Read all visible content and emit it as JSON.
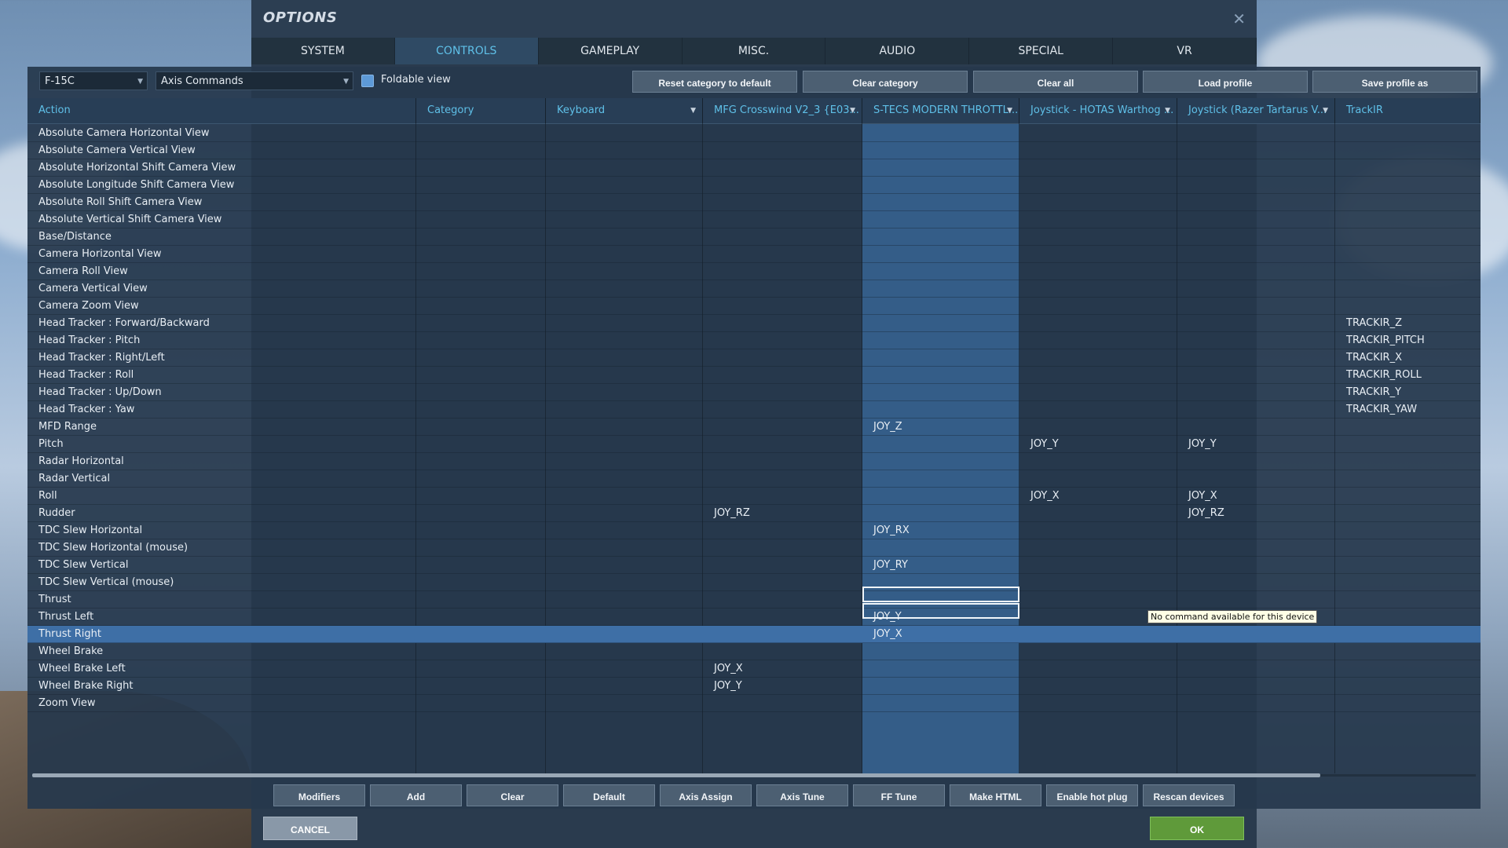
{
  "window": {
    "title": "OPTIONS"
  },
  "tabs": [
    {
      "label": "SYSTEM",
      "active": false
    },
    {
      "label": "CONTROLS",
      "active": true
    },
    {
      "label": "GAMEPLAY",
      "active": false
    },
    {
      "label": "MISC.",
      "active": false
    },
    {
      "label": "AUDIO",
      "active": false
    },
    {
      "label": "SPECIAL",
      "active": false
    },
    {
      "label": "VR",
      "active": false
    }
  ],
  "toolbar": {
    "aircraft": "F-15C",
    "category_filter": "Axis Commands",
    "foldable_label": "Foldable view",
    "reset_category": "Reset category to default",
    "clear_category": "Clear category",
    "clear_all": "Clear all",
    "load_profile": "Load profile",
    "save_profile_as": "Save profile as"
  },
  "columns": [
    {
      "label": "Action",
      "dropdown": false
    },
    {
      "label": "Category",
      "dropdown": false
    },
    {
      "label": "Keyboard",
      "dropdown": true
    },
    {
      "label": "MFG Crosswind V2_3 {E03...",
      "dropdown": true
    },
    {
      "label": "S-TECS MODERN THROTTL...",
      "dropdown": true
    },
    {
      "label": "Joystick - HOTAS Warthog ...",
      "dropdown": true
    },
    {
      "label": "Joystick (Razer Tartarus V...",
      "dropdown": true
    },
    {
      "label": "TrackIR",
      "dropdown": false
    }
  ],
  "rows": [
    {
      "action": "Absolute Camera Horizontal View",
      "category": "",
      "keyboard": "",
      "mfg": "",
      "stecs": "",
      "warthog": "",
      "razer": "",
      "trackir": ""
    },
    {
      "action": "Absolute Camera Vertical View",
      "category": "",
      "keyboard": "",
      "mfg": "",
      "stecs": "",
      "warthog": "",
      "razer": "",
      "trackir": ""
    },
    {
      "action": "Absolute Horizontal Shift Camera View",
      "category": "",
      "keyboard": "",
      "mfg": "",
      "stecs": "",
      "warthog": "",
      "razer": "",
      "trackir": ""
    },
    {
      "action": "Absolute Longitude Shift Camera View",
      "category": "",
      "keyboard": "",
      "mfg": "",
      "stecs": "",
      "warthog": "",
      "razer": "",
      "trackir": ""
    },
    {
      "action": "Absolute Roll Shift Camera View",
      "category": "",
      "keyboard": "",
      "mfg": "",
      "stecs": "",
      "warthog": "",
      "razer": "",
      "trackir": ""
    },
    {
      "action": "Absolute Vertical Shift Camera View",
      "category": "",
      "keyboard": "",
      "mfg": "",
      "stecs": "",
      "warthog": "",
      "razer": "",
      "trackir": ""
    },
    {
      "action": "Base/Distance",
      "category": "",
      "keyboard": "",
      "mfg": "",
      "stecs": "",
      "warthog": "",
      "razer": "",
      "trackir": ""
    },
    {
      "action": "Camera Horizontal View",
      "category": "",
      "keyboard": "",
      "mfg": "",
      "stecs": "",
      "warthog": "",
      "razer": "",
      "trackir": ""
    },
    {
      "action": "Camera Roll View",
      "category": "",
      "keyboard": "",
      "mfg": "",
      "stecs": "",
      "warthog": "",
      "razer": "",
      "trackir": ""
    },
    {
      "action": "Camera Vertical View",
      "category": "",
      "keyboard": "",
      "mfg": "",
      "stecs": "",
      "warthog": "",
      "razer": "",
      "trackir": ""
    },
    {
      "action": "Camera Zoom View",
      "category": "",
      "keyboard": "",
      "mfg": "",
      "stecs": "",
      "warthog": "",
      "razer": "",
      "trackir": ""
    },
    {
      "action": "Head Tracker : Forward/Backward",
      "category": "",
      "keyboard": "",
      "mfg": "",
      "stecs": "",
      "warthog": "",
      "razer": "",
      "trackir": "TRACKIR_Z"
    },
    {
      "action": "Head Tracker : Pitch",
      "category": "",
      "keyboard": "",
      "mfg": "",
      "stecs": "",
      "warthog": "",
      "razer": "",
      "trackir": "TRACKIR_PITCH"
    },
    {
      "action": "Head Tracker : Right/Left",
      "category": "",
      "keyboard": "",
      "mfg": "",
      "stecs": "",
      "warthog": "",
      "razer": "",
      "trackir": "TRACKIR_X"
    },
    {
      "action": "Head Tracker : Roll",
      "category": "",
      "keyboard": "",
      "mfg": "",
      "stecs": "",
      "warthog": "",
      "razer": "",
      "trackir": "TRACKIR_ROLL"
    },
    {
      "action": "Head Tracker : Up/Down",
      "category": "",
      "keyboard": "",
      "mfg": "",
      "stecs": "",
      "warthog": "",
      "razer": "",
      "trackir": "TRACKIR_Y"
    },
    {
      "action": "Head Tracker : Yaw",
      "category": "",
      "keyboard": "",
      "mfg": "",
      "stecs": "",
      "warthog": "",
      "razer": "",
      "trackir": "TRACKIR_YAW"
    },
    {
      "action": "MFD Range",
      "category": "",
      "keyboard": "",
      "mfg": "",
      "stecs": "JOY_Z",
      "warthog": "",
      "razer": "",
      "trackir": ""
    },
    {
      "action": "Pitch",
      "category": "",
      "keyboard": "",
      "mfg": "",
      "stecs": "",
      "warthog": "JOY_Y",
      "razer": "JOY_Y",
      "trackir": ""
    },
    {
      "action": "Radar Horizontal",
      "category": "",
      "keyboard": "",
      "mfg": "",
      "stecs": "",
      "warthog": "",
      "razer": "",
      "trackir": ""
    },
    {
      "action": "Radar Vertical",
      "category": "",
      "keyboard": "",
      "mfg": "",
      "stecs": "",
      "warthog": "",
      "razer": "",
      "trackir": ""
    },
    {
      "action": "Roll",
      "category": "",
      "keyboard": "",
      "mfg": "",
      "stecs": "",
      "warthog": "JOY_X",
      "razer": "JOY_X",
      "trackir": ""
    },
    {
      "action": "Rudder",
      "category": "",
      "keyboard": "",
      "mfg": "JOY_RZ",
      "stecs": "",
      "warthog": "",
      "razer": "JOY_RZ",
      "trackir": ""
    },
    {
      "action": "TDC Slew Horizontal",
      "category": "",
      "keyboard": "",
      "mfg": "",
      "stecs": "JOY_RX",
      "warthog": "",
      "razer": "",
      "trackir": ""
    },
    {
      "action": "TDC Slew Horizontal (mouse)",
      "category": "",
      "keyboard": "",
      "mfg": "",
      "stecs": "",
      "warthog": "",
      "razer": "",
      "trackir": ""
    },
    {
      "action": "TDC Slew Vertical",
      "category": "",
      "keyboard": "",
      "mfg": "",
      "stecs": "JOY_RY",
      "warthog": "",
      "razer": "",
      "trackir": ""
    },
    {
      "action": "TDC Slew Vertical (mouse)",
      "category": "",
      "keyboard": "",
      "mfg": "",
      "stecs": "",
      "warthog": "",
      "razer": "",
      "trackir": ""
    },
    {
      "action": "Thrust",
      "category": "",
      "keyboard": "",
      "mfg": "",
      "stecs": "",
      "warthog": "",
      "razer": "",
      "trackir": ""
    },
    {
      "action": "Thrust Left",
      "category": "",
      "keyboard": "",
      "mfg": "",
      "stecs": "JOY_Y",
      "warthog": "",
      "razer": "",
      "trackir": ""
    },
    {
      "action": "Thrust Right",
      "category": "",
      "keyboard": "",
      "mfg": "",
      "stecs": "JOY_X",
      "warthog": "",
      "razer": "",
      "trackir": "",
      "selected": true
    },
    {
      "action": "Wheel Brake",
      "category": "",
      "keyboard": "",
      "mfg": "",
      "stecs": "",
      "warthog": "",
      "razer": "",
      "trackir": ""
    },
    {
      "action": "Wheel Brake Left",
      "category": "",
      "keyboard": "",
      "mfg": "JOY_X",
      "stecs": "",
      "warthog": "",
      "razer": "",
      "trackir": ""
    },
    {
      "action": "Wheel Brake Right",
      "category": "",
      "keyboard": "",
      "mfg": "JOY_Y",
      "stecs": "",
      "warthog": "",
      "razer": "",
      "trackir": ""
    },
    {
      "action": "Zoom View",
      "category": "",
      "keyboard": "",
      "mfg": "",
      "stecs": "",
      "warthog": "",
      "razer": "",
      "trackir": ""
    }
  ],
  "tooltip": "No command available for this device",
  "bottom_buttons": [
    "Modifiers",
    "Add",
    "Clear",
    "Default",
    "Axis Assign",
    "Axis Tune",
    "FF Tune",
    "Make HTML",
    "Enable hot plug",
    "Rescan devices"
  ],
  "footer": {
    "cancel": "CANCEL",
    "ok": "OK"
  },
  "icons": {
    "close": "close-icon",
    "dropdown": "chevron-down-icon"
  },
  "colors": {
    "accent": "#5fc0e8",
    "selected_row": "#3e6fa6",
    "ok_button": "#5f9a3a"
  }
}
